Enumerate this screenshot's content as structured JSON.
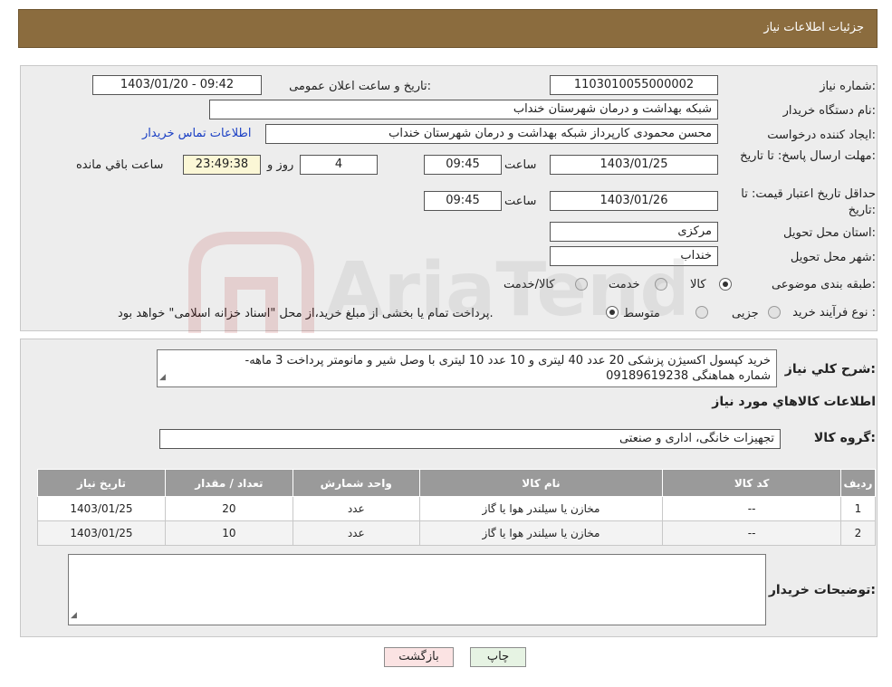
{
  "header": {
    "title": "جزئیات اطلاعات نیاز"
  },
  "fields": {
    "need_number_label": "شماره نیاز:",
    "need_number": "1103010055000002",
    "announce_label": "تاریخ و ساعت اعلان عمومی:",
    "announce_value": "1403/01/20 - 09:42",
    "buyer_org_label": "نام دستگاه خریدار:",
    "buyer_org": "شبکه بهداشت و درمان شهرستان خنداب",
    "requester_label": "ایجاد کننده درخواست:",
    "requester": "محسن محمودی کارپرداز شبکه بهداشت و درمان شهرستان خنداب",
    "contact_link": "اطلاعات تماس خریدار",
    "reply_deadline_label": "مهلت ارسال پاسخ: تا تاریخ:",
    "reply_date": "1403/01/25",
    "time_label": "ساعت",
    "reply_time": "09:45",
    "days_value": "4",
    "days_label": "روز و",
    "remaining_time": "23:49:38",
    "remaining_label": "ساعت باقي مانده",
    "price_validity_label": "حداقل تاریخ اعتبار قیمت: تا تاریخ:",
    "price_date": "1403/01/26",
    "price_time": "09:45",
    "province_label": "استان محل تحویل:",
    "province": "مرکزی",
    "city_label": "شهر محل تحویل:",
    "city": "خنداب",
    "category_label": "طبقه بندی موضوعی:",
    "category_options": [
      "کالا",
      "خدمت",
      "کالا/خدمت"
    ],
    "process_label": "نوع فرآیند خرید :",
    "process_options": [
      "جزیی",
      "متوسط"
    ],
    "process_note": "پرداخت تمام یا بخشی از مبلغ خرید،از محل \"اسناد خزانه اسلامی\" خواهد بود."
  },
  "details": {
    "summary_label": "شرح کلي نياز:",
    "summary_line1": "خرید کپسول اکسیژن پزشکی 20 عدد 40 لیتری و 10 عدد 10 لیتری با وصل شیر و مانومتر پرداخت 3 ماهه-",
    "summary_line2": "شماره هماهنگی 09189619238",
    "goods_info_title": "اطلاعات کالاهاي مورد نياز",
    "goods_group_label": "گروه کالا:",
    "goods_group": "تجهیزات خانگی، اداری و صنعتی",
    "buyer_notes_label": "توضیحات خریدار:"
  },
  "table": {
    "headers": [
      "ردیف",
      "کد کالا",
      "نام کالا",
      "واحد شمارش",
      "تعداد / مقدار",
      "تاریخ نیاز"
    ],
    "rows": [
      [
        "1",
        "--",
        "مخازن یا سیلندر هوا یا گاز",
        "عدد",
        "20",
        "1403/01/25"
      ],
      [
        "2",
        "--",
        "مخازن یا سیلندر هوا یا گاز",
        "عدد",
        "10",
        "1403/01/25"
      ]
    ]
  },
  "buttons": {
    "back": "بازگشت",
    "print": "چاپ"
  },
  "watermark": {
    "text": "AriaTender.neT"
  },
  "colors": {
    "header": "#8b6c3e",
    "panel": "#ededed",
    "table_header": "#9a9a9a",
    "link": "#1a3fc4"
  }
}
